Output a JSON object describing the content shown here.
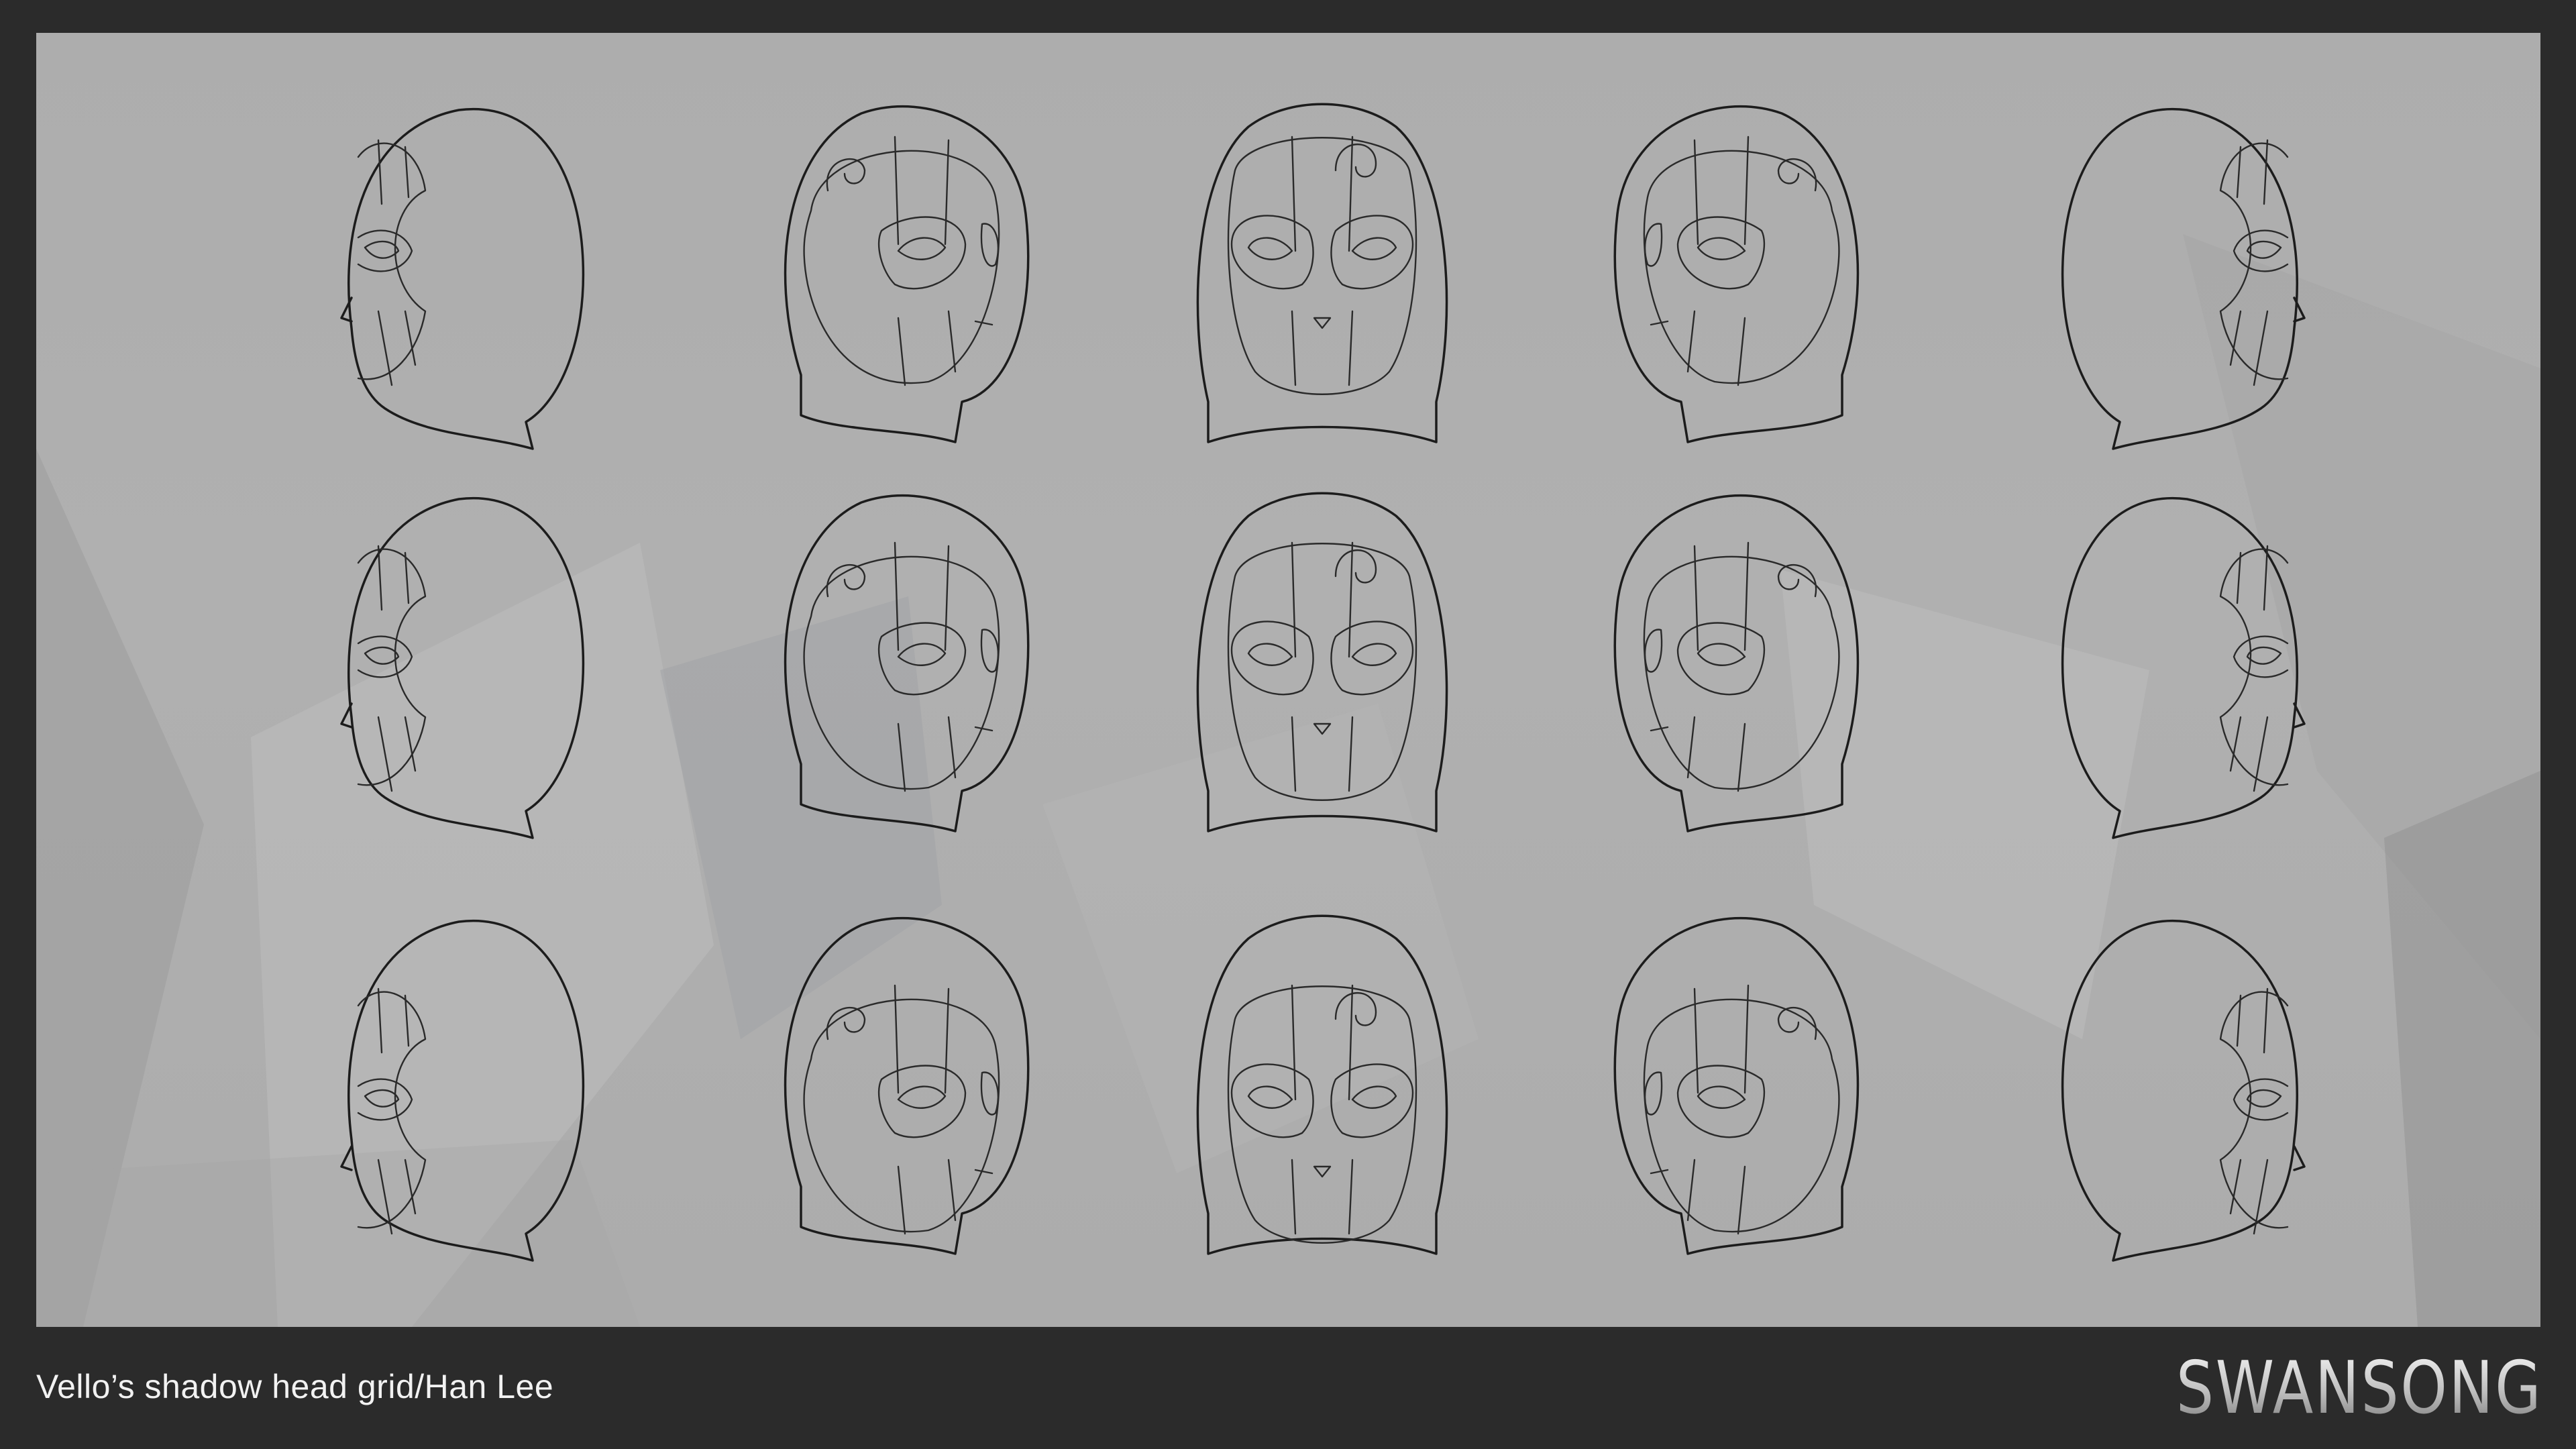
{
  "caption": {
    "text": "Vello’s shadow head grid/Han Lee"
  },
  "logo": {
    "text": "SWANSONG"
  },
  "grid": {
    "views": [
      "side-left",
      "three-quarter-left",
      "front",
      "three-quarter-right",
      "side-right"
    ],
    "tilts": [
      "down",
      "level",
      "up"
    ]
  },
  "colors": {
    "frame": "#2b2b2b",
    "panel": "#adadad",
    "line": "#1c1c1c",
    "caption": "#f2f2f2"
  }
}
